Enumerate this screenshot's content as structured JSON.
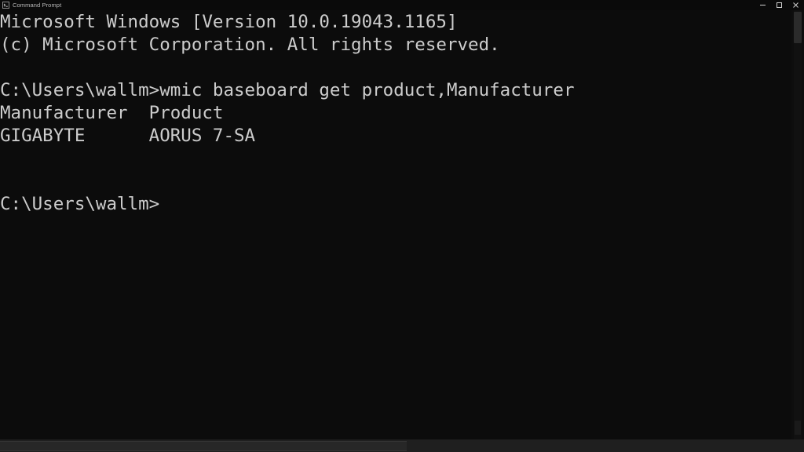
{
  "window": {
    "title": "Command Prompt",
    "app_icon": "console-icon",
    "background_color": "#0c0c0c",
    "text_color": "#cccccc",
    "titlebar_color": "#0a0a0a"
  },
  "titlebar_controls": {
    "minimize_label": "Minimize",
    "maximize_label": "Maximize",
    "close_label": "Close"
  },
  "terminal": {
    "lines": [
      "Microsoft Windows [Version 10.0.19043.1165]",
      "(c) Microsoft Corporation. All rights reserved.",
      "",
      "C:\\Users\\wallm>wmic baseboard get product,Manufacturer",
      "Manufacturer  Product",
      "GIGABYTE      AORUS 7-SA",
      "",
      "",
      "C:\\Users\\wallm>"
    ],
    "version_banner": "Microsoft Windows [Version 10.0.19043.1165]",
    "copyright_banner": "(c) Microsoft Corporation. All rights reserved.",
    "prompt": "C:\\Users\\wallm>",
    "command": "wmic baseboard get product,Manufacturer",
    "result_headers": "Manufacturer  Product",
    "result_row": "GIGABYTE      AORUS 7-SA",
    "manufacturer": "GIGABYTE",
    "product": "AORUS 7-SA"
  },
  "scrollbars": {
    "vertical_name": "vertical-scrollbar",
    "horizontal_name": "horizontal-scrollbar"
  }
}
